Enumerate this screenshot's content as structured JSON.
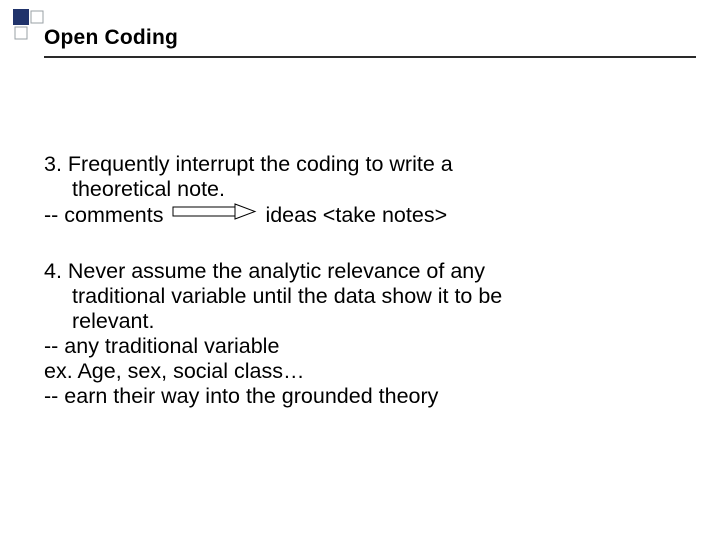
{
  "title": "Open Coding",
  "point3": {
    "line1": "3. Frequently interrupt the coding to write a",
    "line2": "theoretical note.",
    "comments_prefix": "-- comments",
    "comments_suffix": "ideas <take notes>"
  },
  "point4": {
    "line1": "4. Never assume the analytic relevance of any",
    "line2": "traditional variable until the data show it to be",
    "line3": "relevant.",
    "sub1": "-- any traditional variable",
    "sub2": "ex. Age, sex, social class…",
    "sub3": "-- earn their way into the grounded theory"
  }
}
